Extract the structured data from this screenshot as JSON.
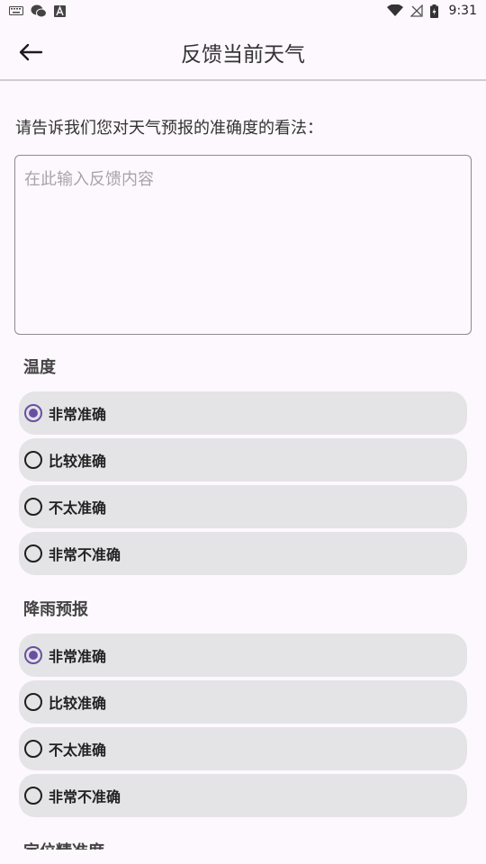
{
  "status_bar": {
    "time": "9:31",
    "icons": [
      "keyboard-icon",
      "wechat-icon",
      "a-badge-icon",
      "wifi-icon",
      "no-signal-icon",
      "battery-charging-icon"
    ]
  },
  "app_bar": {
    "title": "反馈当前天气",
    "back_icon": "arrow-left-icon"
  },
  "prompt": "请告诉我们您对天气预报的准确度的看法：",
  "feedback": {
    "value": "",
    "placeholder": "在此输入反馈内容"
  },
  "sections": [
    {
      "title": "温度",
      "options": [
        {
          "label": "非常准确",
          "selected": true
        },
        {
          "label": "比较准确",
          "selected": false
        },
        {
          "label": "不太准确",
          "selected": false
        },
        {
          "label": "非常不准确",
          "selected": false
        }
      ]
    },
    {
      "title": "降雨预报",
      "options": [
        {
          "label": "非常准确",
          "selected": true
        },
        {
          "label": "比较准确",
          "selected": false
        },
        {
          "label": "不太准确",
          "selected": false
        },
        {
          "label": "非常不准确",
          "selected": false
        }
      ]
    },
    {
      "title": "定位精准度"
    }
  ],
  "colors": {
    "background": "#fdf8fd",
    "accent": "#6750a4",
    "option_bg": "#e4e3e5"
  }
}
